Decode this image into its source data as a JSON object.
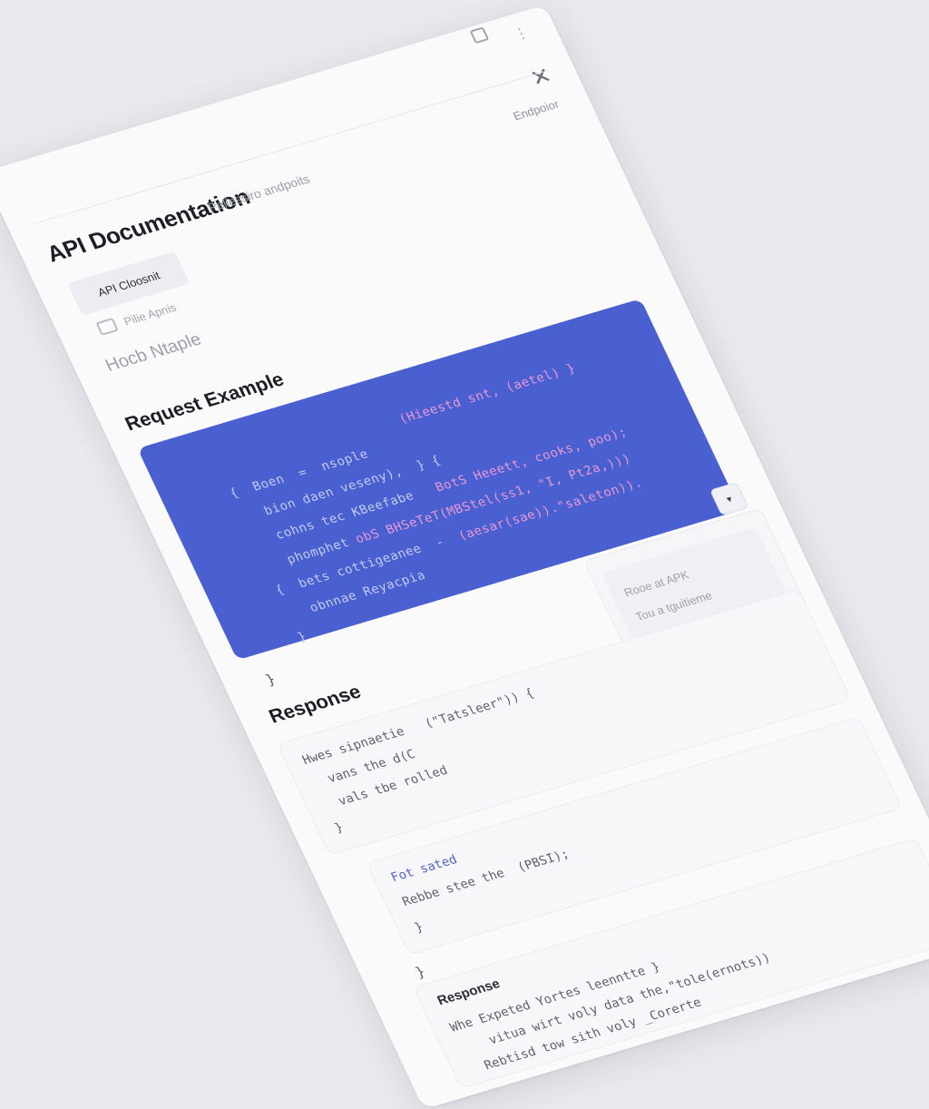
{
  "window": {
    "close_glyph": "✕",
    "menu_glyph": "⋮"
  },
  "header": {
    "title": "API Documentation",
    "breadcrumb": "Pellessiro andpoits",
    "endpoint_label": "Endpoior"
  },
  "sidebar": {
    "active_tab": "API Cloosnit",
    "sub_item": "Pilie Apnis"
  },
  "sections": {
    "faint_heading": "Hocb Ntaple",
    "request_heading": "Request Example",
    "response_heading": "Response",
    "response_heading_2": "Response"
  },
  "request_code": {
    "header_line": "(Hieestd snt, (aetel) }",
    "lines": [
      {
        "text": "{  Boen  =  nsople        ",
        "pink": "(Hieestd snt, (aetel) }"
      },
      {
        "text": "   bion daen veseny),  } ",
        "pink": "{"
      },
      {
        "text": "   cohns tec KBeefabe   ",
        "pink": "BotS Heeett, cooks, poo);"
      },
      {
        "text": "   phomphet ",
        "pink": "obS BHSeTeT(MBStel(ss1, \"I, Pt2a,)))"
      },
      {
        "text": "{  bets cottigeanee  -  ",
        "pink": "(aesar(sae)).\"saleton))."
      },
      {
        "text": "   obnnae Reyacpia",
        "pink": ""
      },
      {
        "text": "}",
        "pink": ""
      }
    ]
  },
  "closing_brace": "}",
  "dropdown_glyph": "▾",
  "side_card": {
    "line1": "Rooe at APK",
    "line2": "Tou a tguitieme"
  },
  "response_code": {
    "lines": [
      "Hwes sipnaetie   (\"Tatsleer\")) {",
      "  vans the d(C",
      "  vals tbe rolled",
      "}"
    ]
  },
  "response_code_2": {
    "lines": [
      "Fot sated",
      "Rebbe stee the  (PBSI);",
      "}"
    ]
  },
  "lower_brace": "}",
  "response_2": {
    "lines": [
      "Whe Expeted Yortes leenntte }",
      "    vitua wirt voly data the,\"tole(ernots))",
      "  Rebtisd tow sith voly _Corerte"
    ]
  }
}
